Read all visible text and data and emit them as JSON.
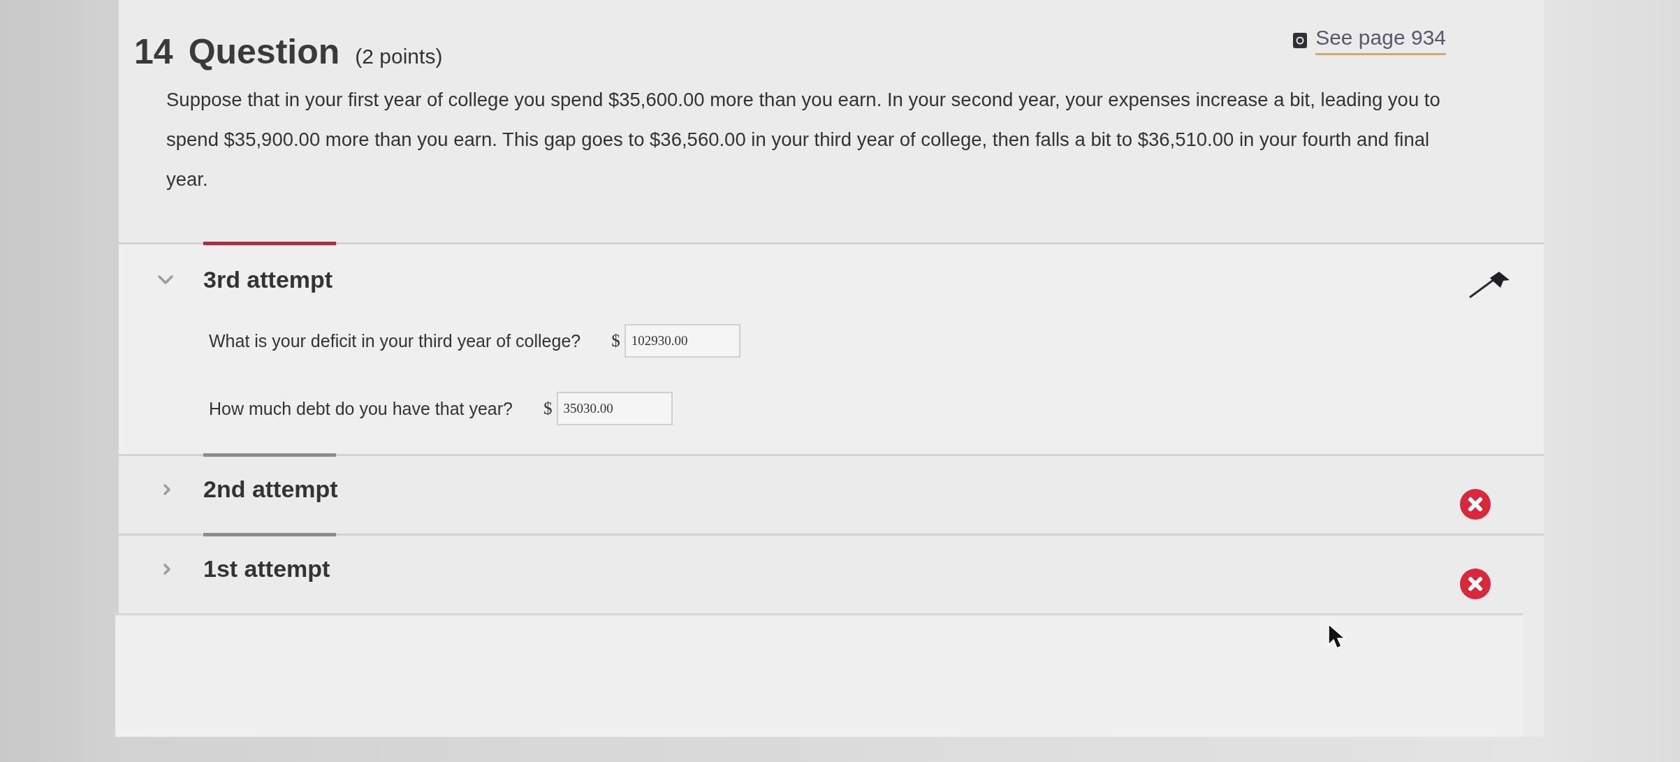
{
  "question": {
    "number": "14",
    "title": "Question",
    "points": "(2 points)",
    "reference": "See page 934",
    "text": "Suppose that in your first year of college you spend $35,600.00 more than you earn. In your second year, your expenses increase a bit, leading you to spend $35,900.00 more than you earn. This gap goes to $36,560.00 in your third year of college, then falls a bit to $36,510.00 in your fourth and final year."
  },
  "attempts": [
    {
      "label": "3rd attempt",
      "expanded": true,
      "kind": "flagged",
      "questions": [
        {
          "prompt": "What is your deficit in your third year of college?",
          "unit": "$",
          "value": "102930.00"
        },
        {
          "prompt": "How much debt do you have that year?",
          "unit": "$",
          "value": "35030.00"
        }
      ]
    },
    {
      "label": "2nd attempt",
      "expanded": false,
      "kind": "incorrect"
    },
    {
      "label": "1st attempt",
      "expanded": false,
      "kind": "incorrect"
    }
  ]
}
